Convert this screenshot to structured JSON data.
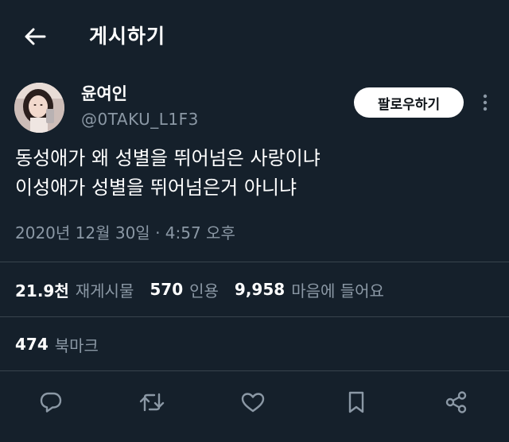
{
  "header": {
    "title": "게시하기",
    "back_icon": "arrow-left-icon"
  },
  "author": {
    "display_name": "윤여인",
    "handle": "@0TAKU_L1F3",
    "follow_label": "팔로우하기",
    "more_icon": "more-vertical-icon"
  },
  "tweet": {
    "lines": [
      "동성애가 왜 성별을 뛰어넘은 사랑이냐",
      "이성애가 성별을 뛰어넘은거 아니냐"
    ],
    "timestamp": "2020년 12월 30일 · 4:57 오후"
  },
  "stats": {
    "retweets": {
      "count": "21.9천",
      "label": "재게시물"
    },
    "quotes": {
      "count": "570",
      "label": "인용"
    },
    "likes": {
      "count": "9,958",
      "label": "마음에 들어요"
    },
    "bookmarks": {
      "count": "474",
      "label": "북마크"
    }
  },
  "actions": {
    "reply": "reply-icon",
    "retweet": "retweet-icon",
    "like": "heart-icon",
    "bookmark": "bookmark-icon",
    "share": "share-icon"
  },
  "colors": {
    "background": "#15202b",
    "text": "#ffffff",
    "secondary_text": "#8b98a5",
    "divider": "#38444d",
    "follow_button_bg": "#ffffff"
  }
}
